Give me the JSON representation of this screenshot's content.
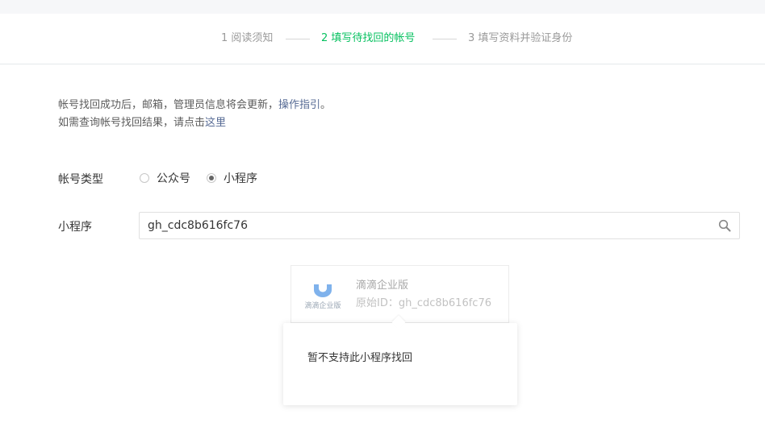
{
  "steps": [
    {
      "label": "1 阅读须知",
      "active": false
    },
    {
      "label": "2 填写待找回的帐号",
      "active": true
    },
    {
      "label": "3 填写资料并验证身份",
      "active": false
    }
  ],
  "notice": {
    "line1_text": "帐号找回成功后，邮箱，管理员信息将会更新，",
    "line1_link": "操作指引",
    "line1_end": "。",
    "line2_text": "如需查询帐号找回结果，请点击",
    "line2_link": "这里"
  },
  "account_type": {
    "label": "帐号类型",
    "options": [
      {
        "label": "公众号",
        "selected": false
      },
      {
        "label": "小程序",
        "selected": true
      }
    ]
  },
  "mini_program": {
    "label": "小程序",
    "search_value": "gh_cdc8b616fc76"
  },
  "result_card": {
    "logo_caption": "滴滴企业版",
    "name": "滴滴企业版",
    "id_text": "原始ID：gh_cdc8b616fc76"
  },
  "popup": {
    "message": "暂不支持此小程序找回"
  },
  "colors": {
    "accent_green": "#07c160",
    "link_blue": "#576b95",
    "logo_blue": "#7fb2ec"
  }
}
